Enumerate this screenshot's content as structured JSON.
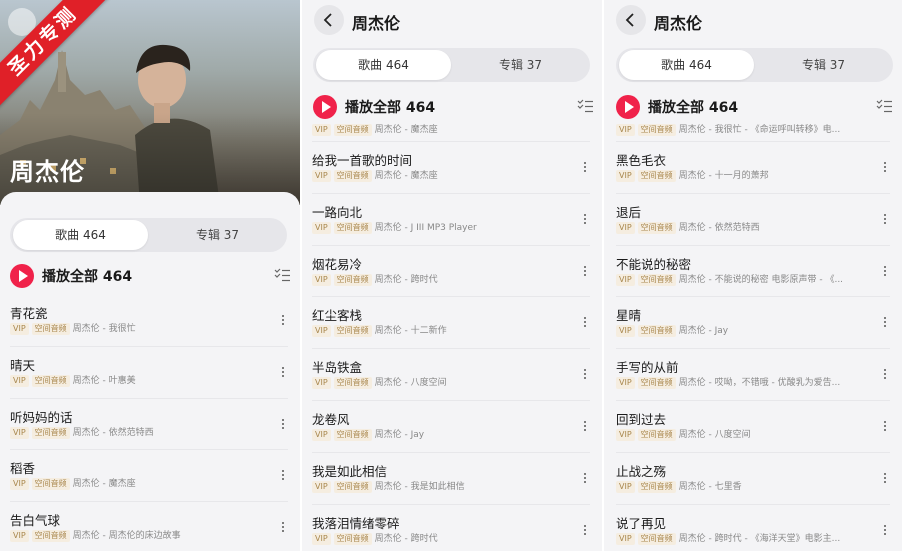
{
  "artist_name": "周杰伦",
  "watermark": "圣力专测",
  "tabs": {
    "songs": "歌曲 464",
    "albums": "专辑 37"
  },
  "play_all": "播放全部 464",
  "tags": {
    "vip": "VIP",
    "spatial": "空间音频"
  },
  "colors": {
    "accent": "#f0224a",
    "vip_tag_bg": "#f5ede0",
    "vip_tag_text": "#a9874d",
    "ribbon": "#e02028"
  },
  "panel1": {
    "songs": [
      {
        "title": "青花瓷",
        "subtitle": "周杰伦 - 我很忙"
      },
      {
        "title": "晴天",
        "subtitle": "周杰伦 - 叶惠美"
      },
      {
        "title": "听妈妈的话",
        "subtitle": "周杰伦 - 依然范特西"
      },
      {
        "title": "稻香",
        "subtitle": "周杰伦 - 魔杰座"
      },
      {
        "title": "告白气球",
        "subtitle": "周杰伦 - 周杰伦的床边故事"
      }
    ]
  },
  "panel2": {
    "partial_subtitle": "周杰伦 - 魔杰座",
    "songs": [
      {
        "title": "给我一首歌的时间",
        "subtitle": "周杰伦 - 魔杰座"
      },
      {
        "title": "一路向北",
        "subtitle": "周杰伦 - J III MP3 Player"
      },
      {
        "title": "烟花易冷",
        "subtitle": "周杰伦 - 跨时代"
      },
      {
        "title": "红尘客栈",
        "subtitle": "周杰伦 - 十二新作"
      },
      {
        "title": "半岛铁盒",
        "subtitle": "周杰伦 - 八度空间"
      },
      {
        "title": "龙卷风",
        "subtitle": "周杰伦 - Jay"
      },
      {
        "title": "我是如此相信",
        "subtitle": "周杰伦 - 我是如此相信"
      },
      {
        "title": "我落泪情绪零碎",
        "subtitle": "周杰伦 - 跨时代"
      }
    ]
  },
  "panel3": {
    "partial_subtitle": "周杰伦 - 我很忙 - 《命运呼叫转移》电...",
    "songs": [
      {
        "title": "黑色毛衣",
        "subtitle": "周杰伦 - 十一月的萧邦"
      },
      {
        "title": "退后",
        "subtitle": "周杰伦 - 依然范特西"
      },
      {
        "title": "不能说的秘密",
        "subtitle": "周杰伦 - 不能说的秘密 电影原声带 - 《..."
      },
      {
        "title": "星晴",
        "subtitle": "周杰伦 - Jay"
      },
      {
        "title": "手写的从前",
        "subtitle": "周杰伦 - 哎呦，不错哦 - 优酸乳为爱告..."
      },
      {
        "title": "回到过去",
        "subtitle": "周杰伦 - 八度空间"
      },
      {
        "title": "止战之殇",
        "subtitle": "周杰伦 - 七里香"
      },
      {
        "title": "说了再见",
        "subtitle": "周杰伦 - 跨时代 - 《海洋天堂》电影主..."
      }
    ]
  }
}
